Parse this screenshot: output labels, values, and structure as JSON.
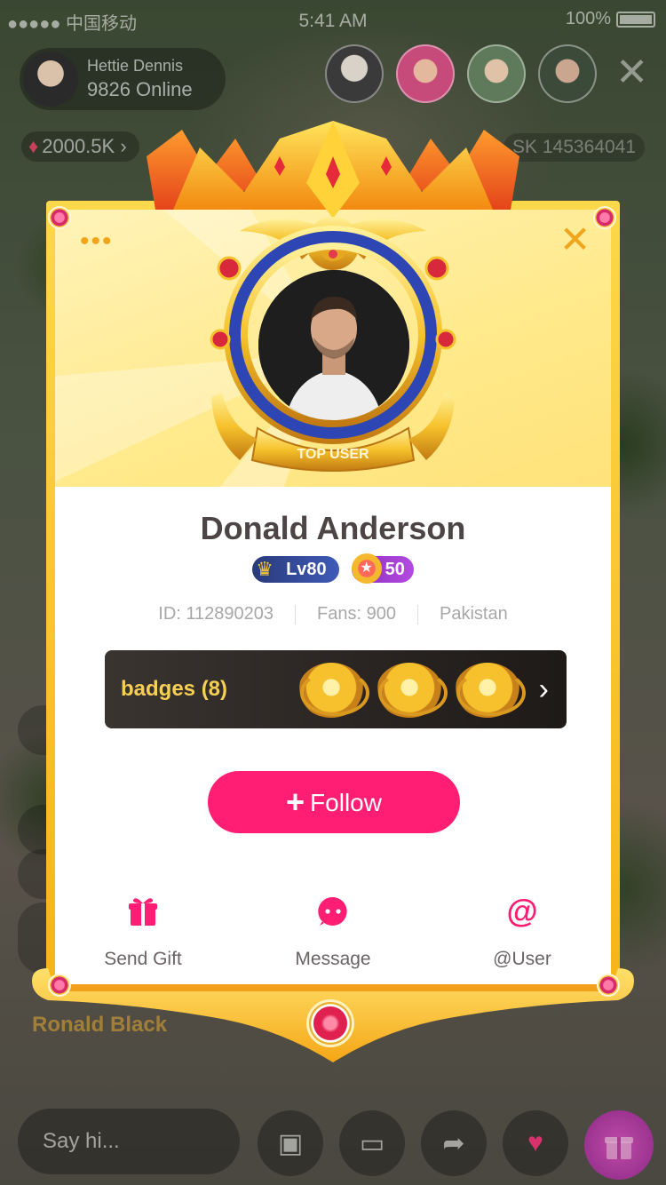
{
  "status_bar": {
    "carrier": "●●●●● 中国移动",
    "time": "5:41 AM",
    "battery": "100%"
  },
  "host": {
    "name": "Hettie Dennis",
    "online": "9826 Online"
  },
  "stream": {
    "diamonds": "2000.5K",
    "room_id": "SK 145364041",
    "chat_visible_name": "Ronald Black"
  },
  "input": {
    "placeholder": "Say hi..."
  },
  "profile": {
    "name": "Donald Anderson",
    "frame_label": "TOP USER",
    "level": "Lv80",
    "star_level": "50",
    "id": "ID: 112890203",
    "fans": "Fans: 900",
    "country": "Pakistan",
    "badges_label": "badges (8)",
    "follow_label": "Follow",
    "actions": [
      {
        "label": "Send Gift",
        "icon": "gift-icon"
      },
      {
        "label": "Message",
        "icon": "chat-bubble-icon"
      },
      {
        "label": "@User",
        "icon": "at-icon"
      }
    ]
  },
  "colors": {
    "accent_pink": "#ff1e73",
    "gold": "#f6b419",
    "badge_text": "#f7cf55"
  }
}
